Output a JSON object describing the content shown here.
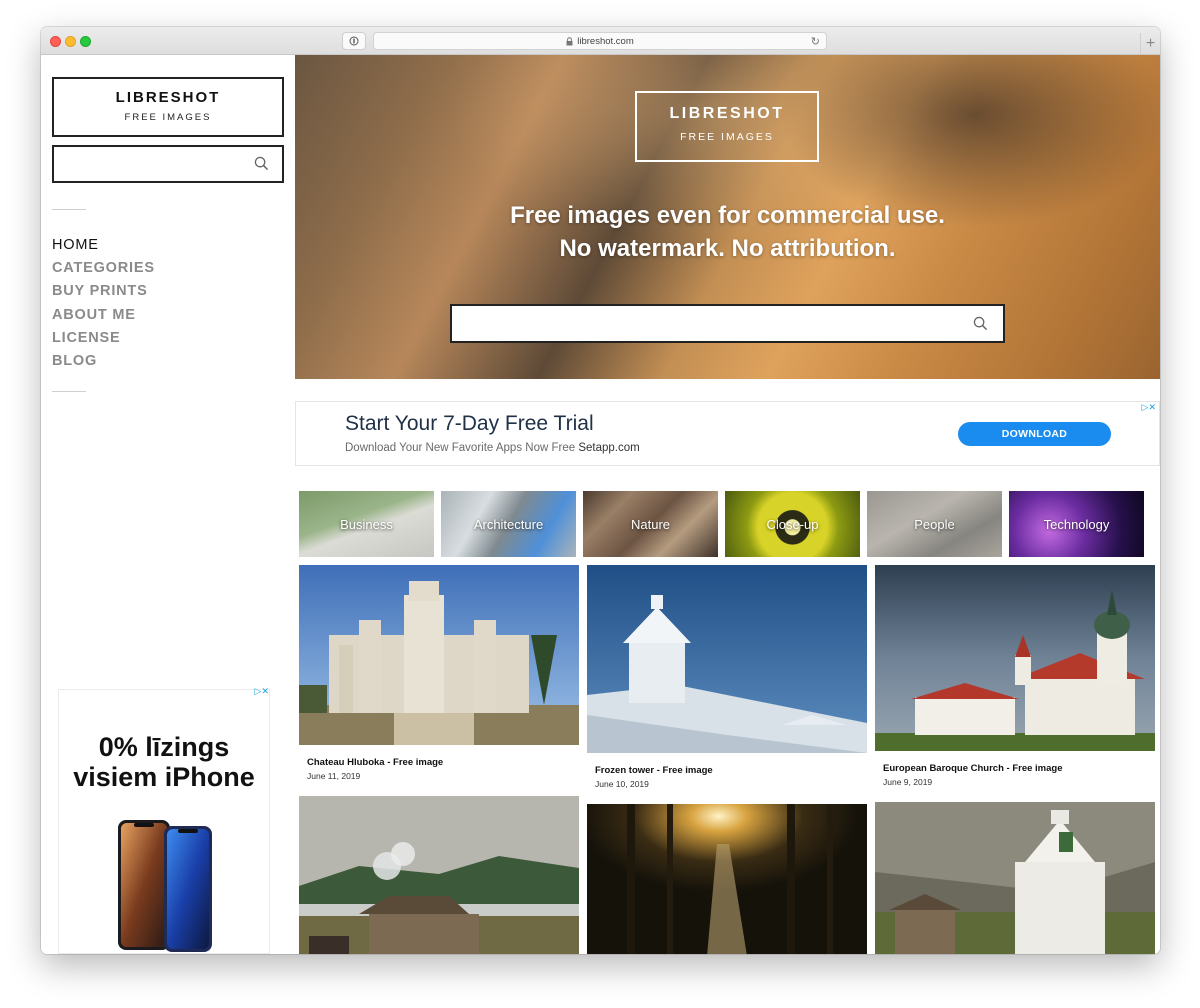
{
  "browser": {
    "url": "libreshot.com"
  },
  "sidebar": {
    "logo_title": "LIBRESHOT",
    "logo_subtitle": "FREE IMAGES",
    "search_placeholder": "",
    "nav": [
      {
        "label": "HOME",
        "active": true
      },
      {
        "label": "CATEGORIES",
        "active": false
      },
      {
        "label": "BUY PRINTS",
        "active": false
      },
      {
        "label": "ABOUT ME",
        "active": false
      },
      {
        "label": "LICENSE",
        "active": false
      },
      {
        "label": "BLOG",
        "active": false
      }
    ],
    "ad": {
      "line1": "0% līzings",
      "line2": "visiem iPhone"
    }
  },
  "hero": {
    "logo_title": "LIBRESHOT",
    "logo_subtitle": "FREE IMAGES",
    "tagline_line1": "Free images even for commercial use.",
    "tagline_line2": "No watermark. No attribution.",
    "search_placeholder": ""
  },
  "banner_ad": {
    "title": "Start Your 7-Day Free Trial",
    "subtitle": "Download Your New Favorite Apps Now Free",
    "brand": "Setapp.com",
    "button": "DOWNLOAD"
  },
  "categories": [
    {
      "label": "Business"
    },
    {
      "label": "Architecture"
    },
    {
      "label": "Nature"
    },
    {
      "label": "Close-up"
    },
    {
      "label": "People"
    },
    {
      "label": "Technology"
    }
  ],
  "photos": [
    {
      "title": "Chateau Hluboka - Free image",
      "date": "June 11, 2019"
    },
    {
      "title": "Frozen tower - Free image",
      "date": "June 10, 2019"
    },
    {
      "title": "European Baroque Church - Free image",
      "date": "June 9, 2019"
    },
    {
      "title": "",
      "date": ""
    },
    {
      "title": "",
      "date": ""
    },
    {
      "title": "",
      "date": ""
    }
  ],
  "colors": {
    "accent_blue": "#1a8cf0",
    "ad_title": "#1f3047",
    "nav_inactive": "#8a8a8a",
    "nav_active": "#111111"
  },
  "icons": {
    "search": "search-icon",
    "lock": "lock-icon",
    "reload": "reload-icon",
    "adchoices": "adchoices-icon"
  }
}
